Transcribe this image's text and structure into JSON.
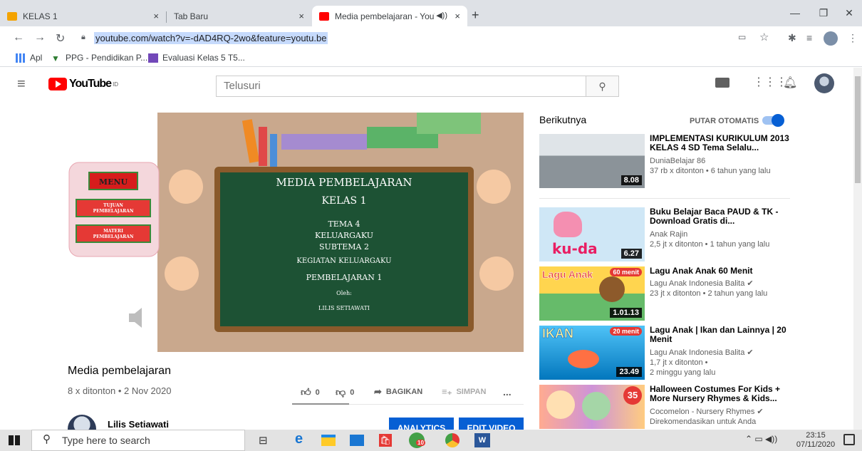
{
  "browser": {
    "tabs": [
      {
        "label": "KELAS 1",
        "close": "×"
      },
      {
        "label": "Tab Baru",
        "close": "×"
      },
      {
        "label": "Media pembelajaran - YouTu",
        "close": "×"
      }
    ],
    "new_tab": "+",
    "url": "youtube.com/watch?v=-dAD4RQ-2wo&feature=youtu.be",
    "bookmarks": [
      "Apl",
      "PPG - Pendidikan P...",
      "Evaluasi Kelas 5 T5..."
    ]
  },
  "youtube": {
    "logo": "YouTube",
    "region": "ID",
    "search_placeholder": "Telusuri"
  },
  "video": {
    "slide": {
      "menu": "MENU",
      "btn1": [
        "TUJUAN",
        "PEMBELAJARAN"
      ],
      "btn2": [
        "MATERI",
        "PEMBELAJARAN"
      ],
      "board": [
        "MEDIA PEMBELAJARAN",
        "KELAS 1",
        "TEMA 4",
        "KELUARGAKU",
        "SUBTEMA 2",
        "KEGIATAN KELUARGAKU",
        "PEMBELAJARAN 1",
        "Oleh:",
        "LILIS SETIAWATI"
      ]
    },
    "title": "Media pembelajaran",
    "views": "8 x ditonton • 2 Nov 2020",
    "likes": "0",
    "dislikes": "0",
    "share": "BAGIKAN",
    "save": "SIMPAN",
    "more": "...",
    "channel": "Lilis Setiawati",
    "analytics": "ANALYTICS",
    "edit": "EDIT VIDEO"
  },
  "sidebar": {
    "next_label": "Berikutnya",
    "autoplay_label": "PUTAR OTOMATIS",
    "items": [
      {
        "title": "IMPLEMENTASI KURIKULUM 2013 KELAS 4 SD Tema Selalu...",
        "channel": "DuniaBelajar 86",
        "stats": "37 rb x ditonton • 6 tahun yang lalu",
        "stats2": "",
        "duration": "8.08"
      },
      {
        "title": "Buku Belajar Baca PAUD & TK - Download Gratis di...",
        "channel": "Anak Rajin",
        "stats": "2,5 jt x ditonton • 1 tahun yang lalu",
        "stats2": "",
        "duration": "6.27",
        "thumb_text": "ku-da"
      },
      {
        "title": "Lagu Anak Anak 60 Menit",
        "channel": "Lagu Anak Indonesia Balita ✔",
        "stats": "23 jt x ditonton • 2 tahun yang lalu",
        "stats2": "",
        "duration": "1.01.13",
        "badge": "60 menit",
        "thumb_text": "Lagu Anak"
      },
      {
        "title": "Lagu Anak | Ikan dan Lainnya | 20 Menit",
        "channel": "Lagu Anak Indonesia Balita ✔",
        "stats": "1,7 jt x ditonton •",
        "stats2": "2 minggu yang lalu",
        "duration": "23.49",
        "badge": "20 menit",
        "thumb_text": "IKAN"
      },
      {
        "title": "Halloween Costumes For Kids + More Nursery Rhymes & Kids...",
        "channel": "Cocomelon - Nursery Rhymes ✔",
        "stats": "Direkomendasikan untuk Anda",
        "stats2": "",
        "duration": "",
        "badge": "35"
      }
    ]
  },
  "taskbar": {
    "search_placeholder": "Type here to search",
    "time": "23:15",
    "date": "07/11/2020",
    "mail_badge": "10"
  },
  "colors": {
    "youtube_red": "#ff0000",
    "link_blue": "#065fd4",
    "chalkboard": "#1d5234"
  }
}
